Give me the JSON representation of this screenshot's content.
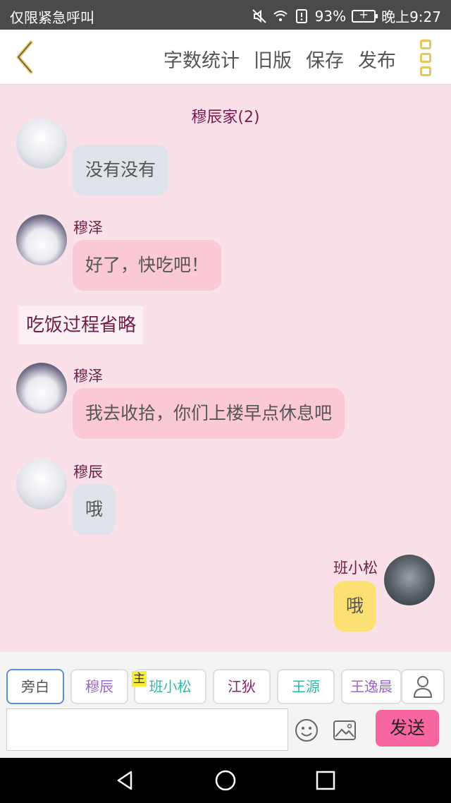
{
  "status_bar": {
    "carrier": "仅限紧急呼叫",
    "battery": "93%",
    "time": "晚上9:27",
    "icons": [
      "mute-icon",
      "wifi-icon",
      "alert-icon",
      "battery-icon"
    ]
  },
  "header": {
    "actions": [
      "字数统计",
      "旧版",
      "保存",
      "发布"
    ]
  },
  "chat": {
    "title": "穆辰家(2)",
    "messages": [
      {
        "sender": "",
        "text": "没有没有",
        "side": "left",
        "color": "gray"
      },
      {
        "sender": "穆泽",
        "text": "好了，快吃吧！",
        "side": "left",
        "color": "pink"
      },
      {
        "narration": "吃饭过程省略"
      },
      {
        "sender": "穆泽",
        "text": "我去收拾，你们上楼早点休息吧",
        "side": "left",
        "color": "pink"
      },
      {
        "sender": "穆辰",
        "text": "哦",
        "side": "left",
        "color": "gray"
      },
      {
        "sender": "班小松",
        "text": "哦",
        "side": "right",
        "color": "yellow"
      }
    ]
  },
  "characters": [
    {
      "label": "旁白",
      "color": "#555555"
    },
    {
      "label": "穆辰",
      "color": "#9b67c8"
    },
    {
      "label": "班小松",
      "color": "#2fb9a8"
    },
    {
      "label": "江狄",
      "color": "#8f1f6e"
    },
    {
      "label": "王源",
      "color": "#2fb9a8"
    },
    {
      "label": "王逸晨",
      "color": "#9b67c8"
    }
  ],
  "host_tag": "主",
  "composer": {
    "value": "",
    "send_label": "发送"
  },
  "colors": {
    "background": "#fae1e9",
    "send": "#f866a0",
    "accent": "#e8c75a"
  }
}
